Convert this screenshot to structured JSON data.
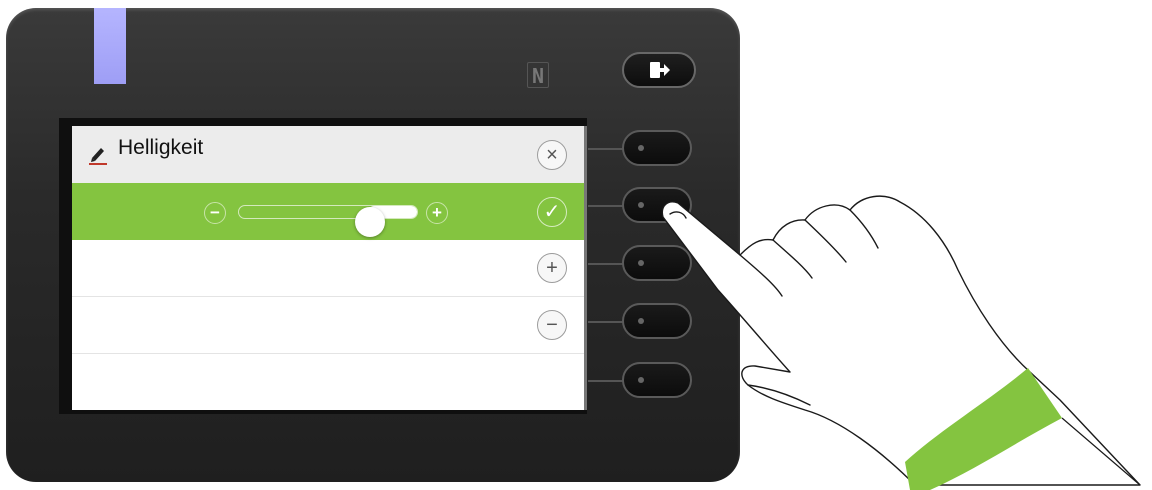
{
  "display": {
    "title": "Helligkeit",
    "close_symbol": "×",
    "ok_symbol": "✓",
    "plus_symbol": "+",
    "minus_symbol": "−",
    "slider": {
      "minus_symbol": "−",
      "plus_symbol": "+",
      "level": 0.73
    }
  },
  "icons": {
    "title_icon": "pencil-icon",
    "exit_key_icon": "exit-arrow-icon",
    "nfc_icon": "nfc-icon"
  },
  "colors": {
    "selection": "#84c440",
    "led": "#b5b5ff",
    "cuff": "#84c440"
  }
}
